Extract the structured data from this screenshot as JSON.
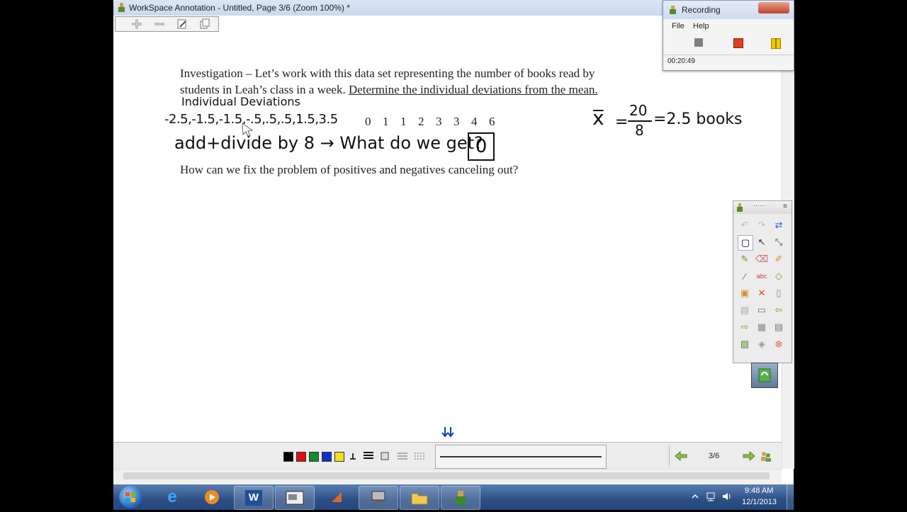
{
  "window": {
    "title": "WorkSpace Annotation - Untitled, Page 3/6  (Zoom 100%) *"
  },
  "document": {
    "paragraph1_line1": "Investigation – Let’s work with this data set representing  the number of books read by",
    "paragraph1_line2_plain": "students in Leah’s class  in a week.  ",
    "paragraph1_line2_underlined": "Determine the individual deviations from the mean.",
    "data_values": [
      "0",
      "1",
      "1",
      "2",
      "3",
      "3",
      "4",
      "6"
    ],
    "question": "How can we fix the problem  of positives and negatives canceling out?"
  },
  "handwriting": {
    "heading": "Individual Deviations",
    "deviations": "-2.5,-1.5,-1.5,-.5,.5,.5,1.5,3.5",
    "instruction": "add+divide by 8 → What do we get?",
    "answer": "0",
    "mean_symbol": "x̅",
    "mean_numerator": "20",
    "mean_denominator": "8",
    "mean_result": "=2.5 books"
  },
  "recording": {
    "title": "Recording",
    "menu": [
      "File",
      "Help"
    ],
    "elapsed": "00:20:49"
  },
  "navigation": {
    "page_indicator": "3/6"
  },
  "colors": {
    "palette": [
      "#000000",
      "#e01010",
      "#1a8a2a",
      "#1030d0",
      "#f0e020"
    ],
    "accent": "#2c4f86"
  },
  "taskbar": {
    "apps": [
      "internet-explorer",
      "media-player",
      "word",
      "workspace",
      "powerpoint",
      "network",
      "explorer",
      "recorder"
    ],
    "time": "9:48 AM",
    "date": "12/1/2013"
  }
}
